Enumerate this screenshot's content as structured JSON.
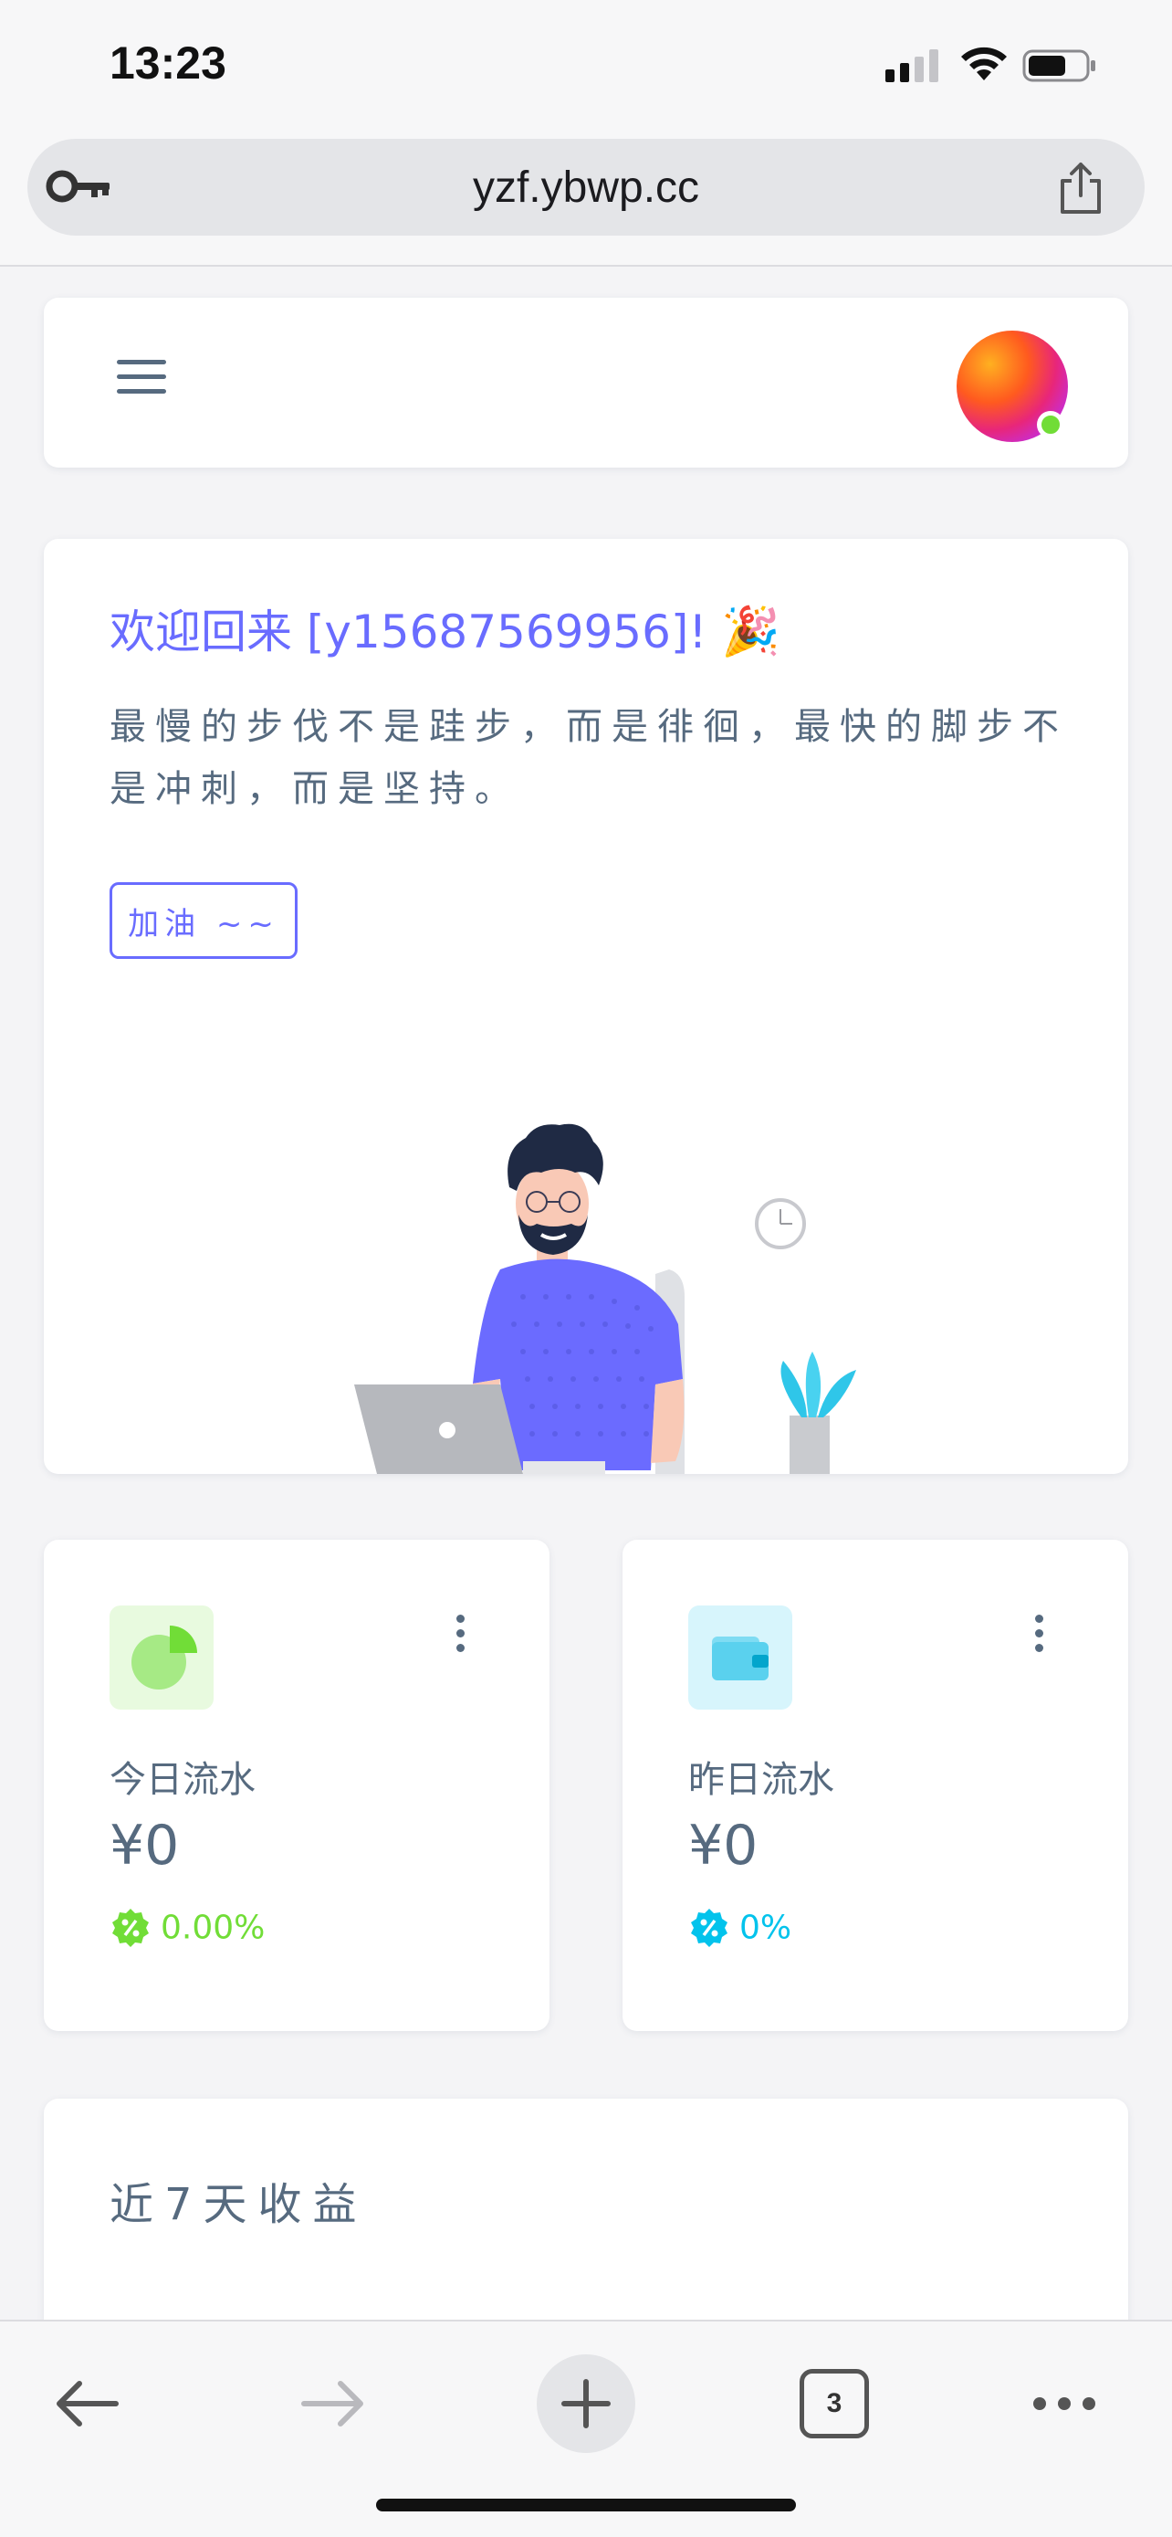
{
  "status_bar": {
    "time": "13:23"
  },
  "browser": {
    "url": "yzf.ybwp.cc",
    "tab_count": "3"
  },
  "welcome": {
    "title": "欢迎回来 [y15687569956]!",
    "emoji": "🎉",
    "quote": "最慢的步伐不是跬步，而是徘徊，最快的脚步不是冲刺，而是坚持。",
    "button_label": "加油 ~~"
  },
  "stats": [
    {
      "label": "今日流水",
      "amount": "¥0",
      "change": "0.00%",
      "color": "#71dd37",
      "icon": "pie-chart-icon"
    },
    {
      "label": "昨日流水",
      "amount": "¥0",
      "change": "0%",
      "color": "#03c3ec",
      "icon": "wallet-icon"
    }
  ],
  "revenue": {
    "title": "近7天收益"
  },
  "colors": {
    "primary": "#696cff",
    "success": "#71dd37",
    "info": "#03c3ec",
    "text": "#566a7f"
  }
}
